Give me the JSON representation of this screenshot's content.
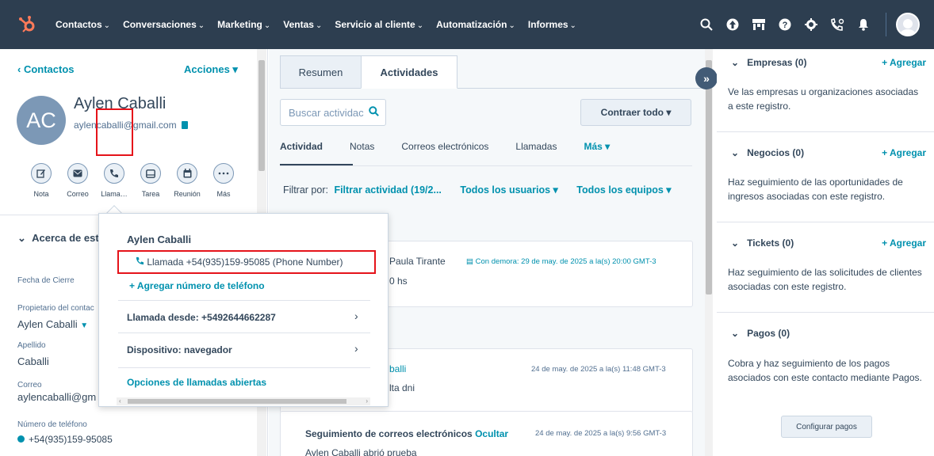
{
  "nav": {
    "items": [
      {
        "label": "Contactos"
      },
      {
        "label": "Conversaciones"
      },
      {
        "label": "Marketing"
      },
      {
        "label": "Ventas"
      },
      {
        "label": "Servicio al cliente"
      },
      {
        "label": "Automatización"
      },
      {
        "label": "Informes"
      }
    ],
    "chevron": "⌄"
  },
  "left": {
    "back": "‹ Contactos",
    "acciones": "Acciones ▾",
    "initials": "AC",
    "name": "Aylen Caballi",
    "email": "aylencaballi@gmail.com",
    "actions": [
      "Nota",
      "Correo",
      "Llama…",
      "Tarea",
      "Reunión",
      "Más"
    ],
    "about": "Acerca de est",
    "fields": {
      "fecha_cierre_label": "Fecha de Cierre",
      "propietario_label": "Propietario del contac",
      "propietario_value": "Aylen Caballi",
      "apellido_label": "Apellido",
      "apellido_value": "Caballi",
      "correo_label": "Correo",
      "correo_value": "aylencaballi@gm",
      "telefono_label": "Número de teléfono",
      "telefono_value": "+54(935)159-95085"
    }
  },
  "mid": {
    "tabs": [
      "Resumen",
      "Actividades"
    ],
    "search_placeholder": "Buscar actividac",
    "contraer": "Contraer todo ▾",
    "subtabs": [
      "Actividad",
      "Notas",
      "Correos electrónicos",
      "Llamadas",
      "Más ▾"
    ],
    "filter_label": "Filtrar por:",
    "filter_activity": "Filtrar actividad (19/2...",
    "filter_users": "Todos los usuarios ▾",
    "filter_teams": "Todos los equipos ▾",
    "card1": {
      "author": "Paula Tirante",
      "overdue": "Con demora: 29 de may. de 2025 a la(s) 20:00 GMT-3",
      "text": "0 hs"
    },
    "card2": {
      "author": "balli",
      "date": "24 de may. de 2025 a la(s) 11:48 GMT-3",
      "text": "lta dni"
    },
    "card3": {
      "title": "Seguimiento de correos electrónicos",
      "hide": "Ocultar",
      "date": "24 de may. de 2025 a la(s) 9:56 GMT-3",
      "text": "Aylen Caballi abrió prueba"
    }
  },
  "popup": {
    "title": "Aylen Caballi",
    "call": "Llamada +54(935)159-95085 (Phone Number)",
    "add_phone": "+ Agregar número de teléfono",
    "from": "Llamada desde: +5492644662287",
    "device": "Dispositivo: navegador",
    "open_options": "Opciones de llamadas abiertas"
  },
  "right": {
    "sections": [
      {
        "title": "Empresas (0)",
        "add": "+ Agregar",
        "text": "Ve las empresas u organizaciones asociadas a este registro."
      },
      {
        "title": "Negocios (0)",
        "add": "+ Agregar",
        "text": "Haz seguimiento de las oportunidades de ingresos asociadas con este registro."
      },
      {
        "title": "Tickets (0)",
        "add": "+ Agregar",
        "text": "Haz seguimiento de las solicitudes de clientes asociadas con este registro."
      },
      {
        "title": "Pagos (0)",
        "add": "",
        "text": "Cobra y haz seguimiento de los pagos asociados con este contacto mediante Pagos."
      }
    ],
    "config_btn": "Configurar pagos",
    "chevron": "⌄"
  },
  "colors": {
    "nav_bg": "#2d3e50",
    "link": "#0091ae",
    "accent": "#ff7a59",
    "highlight": "#e5131a"
  }
}
